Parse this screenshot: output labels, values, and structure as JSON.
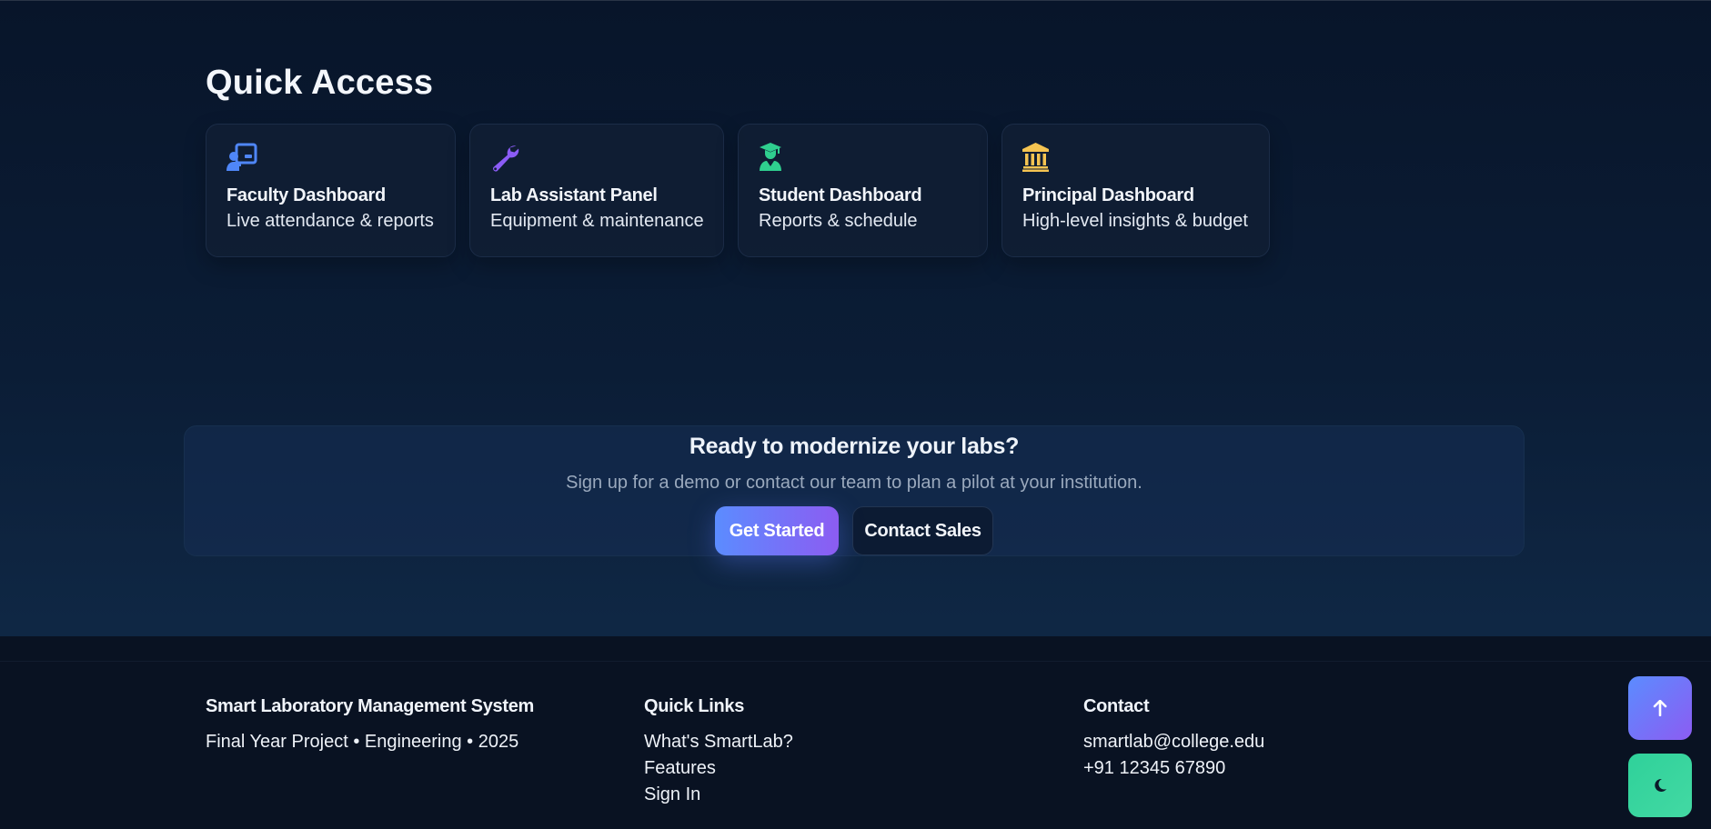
{
  "quick_access": {
    "title": "Quick Access",
    "cards": [
      {
        "icon": "chalkboard-teacher-icon",
        "color": "#4f86f7",
        "title": "Faculty Dashboard",
        "subtitle": "Live attendance & reports"
      },
      {
        "icon": "wrench-icon",
        "color": "#8b5cf6",
        "title": "Lab Assistant Panel",
        "subtitle": "Equipment & maintenance"
      },
      {
        "icon": "graduate-student-icon",
        "color": "#2fcf8f",
        "title": "Student Dashboard",
        "subtitle": "Reports & schedule"
      },
      {
        "icon": "bank-building-icon",
        "color": "#f5c451",
        "title": "Principal Dashboard",
        "subtitle": "High-level insights & budget"
      }
    ]
  },
  "cta": {
    "title": "Ready to modernize your labs?",
    "subtitle": "Sign up for a demo or contact our team to plan a pilot at your institution.",
    "primary_label": "Get Started",
    "secondary_label": "Contact Sales"
  },
  "footer": {
    "about": {
      "title": "Smart Laboratory Management System",
      "line": "Final Year Project • Engineering • 2025"
    },
    "links": {
      "title": "Quick Links",
      "items": [
        "What's SmartLab?",
        "Features",
        "Sign In"
      ]
    },
    "contact": {
      "title": "Contact",
      "email": "smartlab@college.edu",
      "phone": "+91 12345 67890"
    }
  },
  "floating": {
    "scroll_top_icon": "arrow-up-icon",
    "theme_toggle_icon": "moon-icon"
  }
}
